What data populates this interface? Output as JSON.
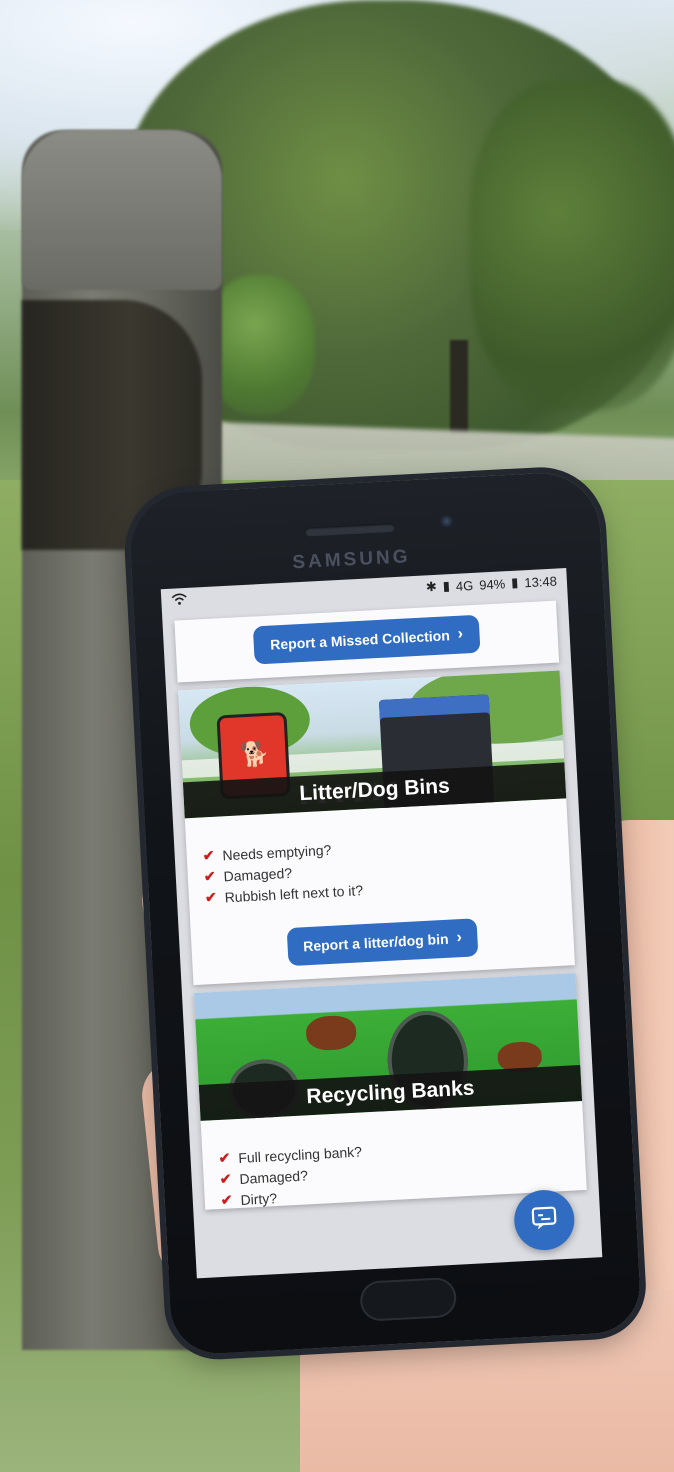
{
  "phone": {
    "brand": "SAMSUNG",
    "status": {
      "battery": "94%",
      "time": "13:48",
      "network": "4G"
    }
  },
  "app": {
    "top_button": "Report a Missed Collection",
    "litter": {
      "title": "Litter/Dog Bins",
      "items": [
        "Needs emptying?",
        "Damaged?",
        "Rubbish left next to it?"
      ],
      "button": "Report a litter/dog bin"
    },
    "recycling": {
      "title": "Recycling Banks",
      "items": [
        "Full recycling bank?",
        "Damaged?",
        "Dirty?"
      ]
    }
  },
  "colors": {
    "primary": "#2f6cc2",
    "check": "#cc1d1d",
    "banner": "#141414"
  },
  "icons": {
    "chevron": "chevron-right-icon",
    "check": "check-icon",
    "chat": "chat-icon",
    "wifi": "wifi-icon",
    "bluetooth": "bluetooth-icon",
    "battery": "battery-icon",
    "signal": "signal-icon"
  }
}
